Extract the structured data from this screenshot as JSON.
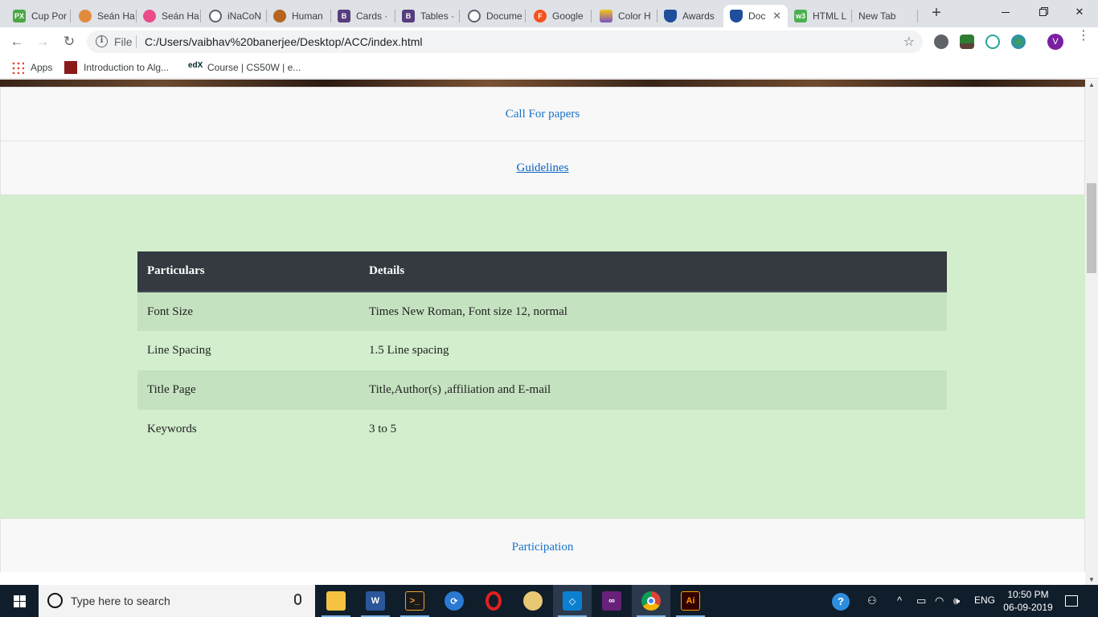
{
  "browser": {
    "tabs": [
      {
        "title": "Cup Por",
        "icon": "px-icon",
        "color": "#4ba845",
        "glyph": "PX"
      },
      {
        "title": "Seán Ha",
        "icon": "avatar-icon",
        "color": "#e28b3a",
        "glyph": ""
      },
      {
        "title": "Seán Ha",
        "icon": "dribbble-icon",
        "color": "#ea4c89",
        "glyph": ""
      },
      {
        "title": "iNaCoN",
        "icon": "globe-icon",
        "color": "#5f6368",
        "glyph": ""
      },
      {
        "title": "Human",
        "icon": "mascot-icon",
        "color": "#b5651d",
        "glyph": ""
      },
      {
        "title": "Cards ·",
        "icon": "bootstrap-icon",
        "color": "#563d7c",
        "glyph": "B"
      },
      {
        "title": "Tables ·",
        "icon": "bootstrap-icon",
        "color": "#563d7c",
        "glyph": "B"
      },
      {
        "title": "Docume",
        "icon": "globe-icon",
        "color": "#5f6368",
        "glyph": ""
      },
      {
        "title": "Google",
        "icon": "fonts-icon",
        "color": "#f4511e",
        "glyph": "F"
      },
      {
        "title": "Color H",
        "icon": "color-icon",
        "color": "#7a52c7",
        "glyph": ""
      },
      {
        "title": "Awards",
        "icon": "shield-icon",
        "color": "#1e4e9c",
        "glyph": ""
      },
      {
        "title": "Doc",
        "icon": "shield-icon",
        "color": "#1e4e9c",
        "glyph": ""
      },
      {
        "title": "HTML L",
        "icon": "w3-icon",
        "color": "#4caf50",
        "glyph": "w3"
      },
      {
        "title": "New Tab",
        "icon": "",
        "color": "",
        "glyph": ""
      }
    ],
    "address": {
      "scheme_label": "File",
      "url": "C:/Users/vaibhav%20banerjee/Desktop/ACC/index.html"
    },
    "profile_initial": "V",
    "bookmarks": [
      {
        "label": "Apps",
        "icon": "apps-grid-icon"
      },
      {
        "label": "Introduction to Alg...",
        "icon": "mit-ocw-icon"
      },
      {
        "label": "Course | CS50W | e...",
        "icon": "edx-icon"
      }
    ]
  },
  "page": {
    "nav_items": {
      "call_for_papers": "Call For papers",
      "guidelines": "Guidelines",
      "participation": "Participation"
    },
    "table": {
      "headers": [
        "Particulars",
        "Details"
      ],
      "rows": [
        [
          "Font Size",
          "Times New Roman, Font size 12, normal"
        ],
        [
          "Line Spacing",
          "1.5 Line spacing"
        ],
        [
          "Title Page",
          "Title,Author(s) ,affiliation and E-mail"
        ],
        [
          "Keywords",
          "3 to 5"
        ]
      ]
    }
  },
  "taskbar": {
    "search_placeholder": "Type here to search",
    "language": "ENG",
    "time": "10:50 PM",
    "date": "06-09-2019"
  },
  "colors": {
    "link": "#1a73c9",
    "section_green": "#d2eecd",
    "table_header": "#343a40",
    "taskbar": "#101d2b"
  }
}
